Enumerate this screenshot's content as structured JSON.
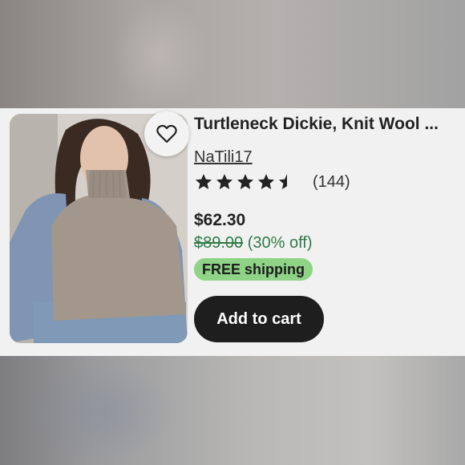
{
  "listing": {
    "title": "Turtleneck Dickie, Knit Wool ...",
    "shop_name": "NaTili17",
    "rating": 4.5,
    "review_count": "(144)",
    "price": "$62.30",
    "original_price": "$89.00",
    "discount": "(30% off)",
    "shipping_badge": "FREE shipping",
    "add_to_cart_label": "Add to cart",
    "favorite_icon": "heart-outline-icon",
    "colors": {
      "price_green": "#2f7a45",
      "shipping_badge_bg": "#8ed386",
      "cart_button_bg": "#1e1e1e"
    }
  }
}
